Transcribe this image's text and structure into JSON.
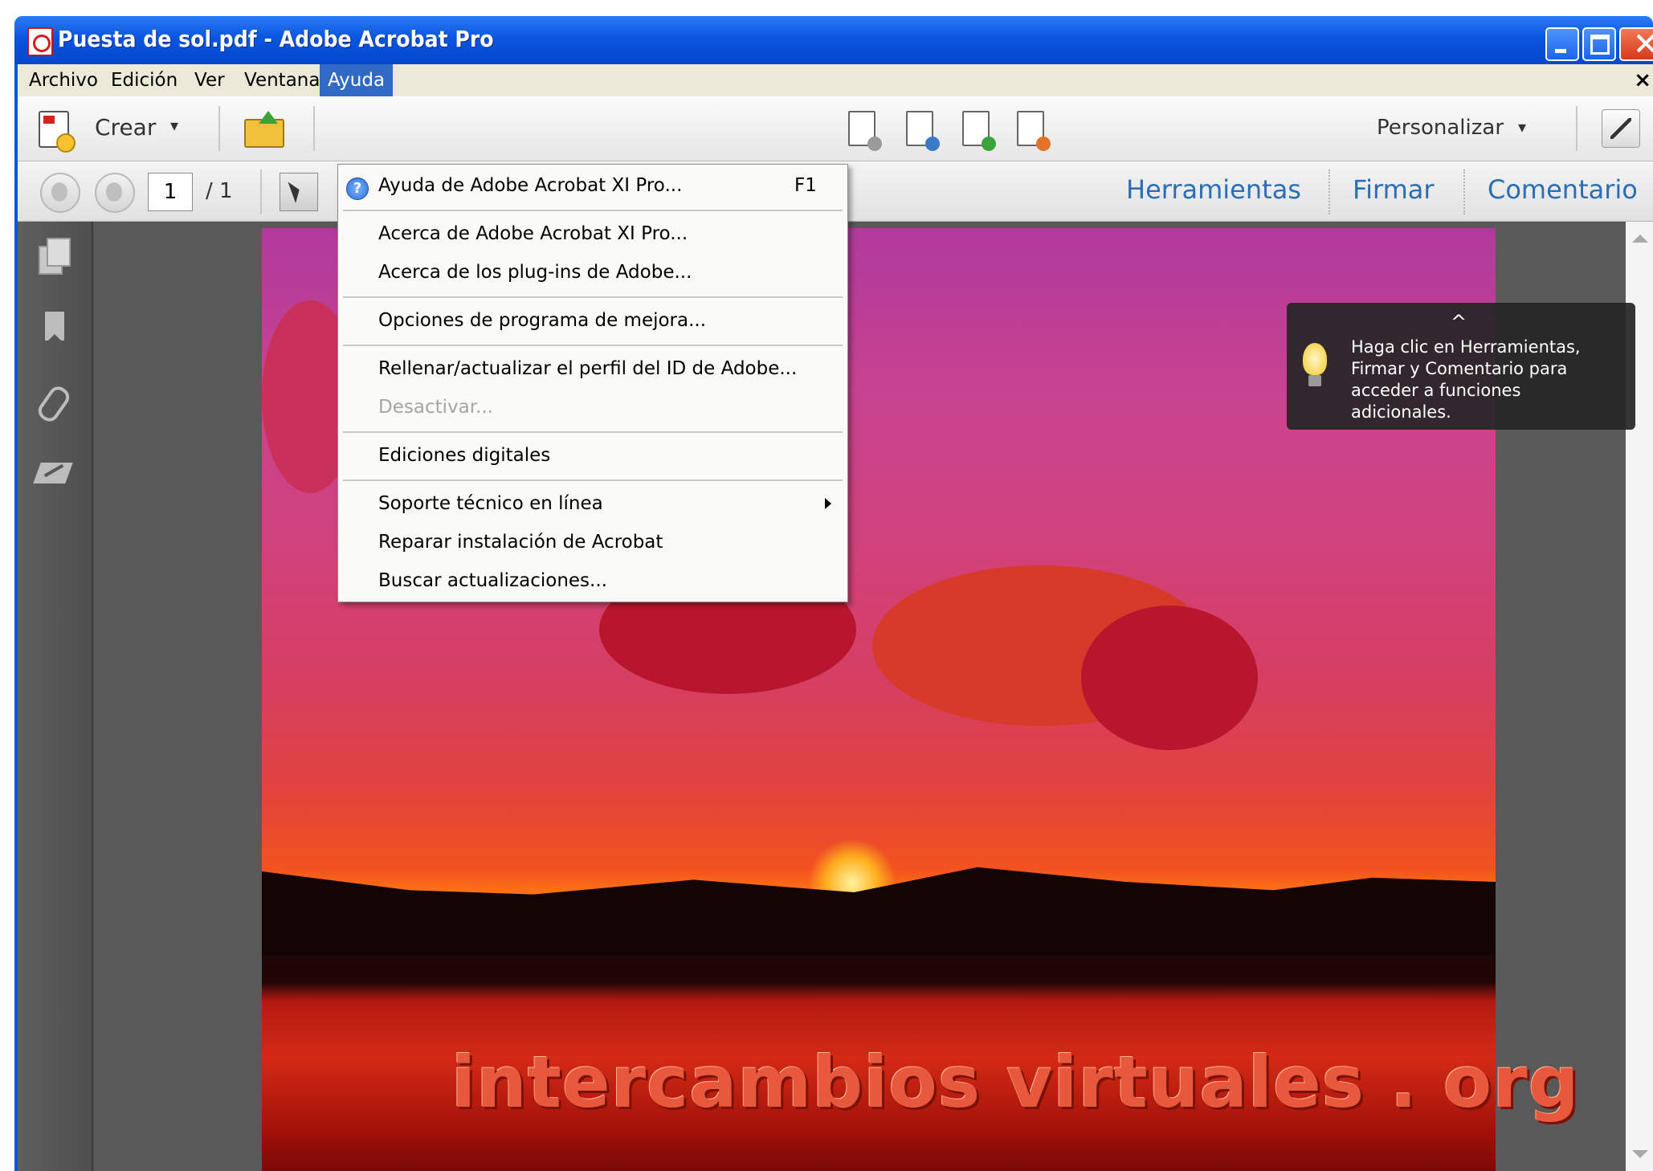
{
  "window": {
    "title": "Puesta de sol.pdf - Adobe Acrobat Pro"
  },
  "menubar": {
    "items": [
      {
        "label": "Archivo"
      },
      {
        "label": "Edición"
      },
      {
        "label": "Ver"
      },
      {
        "label": "Ventana"
      },
      {
        "label": "Ayuda",
        "active": true
      }
    ],
    "close_glyph": "×"
  },
  "toolbar": {
    "create_label": "Crear",
    "create_arrow": "▾",
    "customize_label": "Personalizar",
    "customize_arrow": "▾"
  },
  "navbar": {
    "page_current": "1",
    "page_total": "/ 1",
    "panes": [
      "Herramientas",
      "Firmar",
      "Comentario"
    ]
  },
  "help_menu": {
    "items": [
      {
        "label": "Ayuda de Adobe Acrobat XI Pro...",
        "shortcut": "F1",
        "icon": "help-circle-icon",
        "enabled": true
      },
      {
        "label": "Acerca de Adobe Acrobat XI Pro...",
        "enabled": true
      },
      {
        "label": "Acerca de los plug-ins de Adobe...",
        "enabled": true
      },
      {
        "label": "Opciones de programa de mejora...",
        "enabled": true
      },
      {
        "label": "Rellenar/actualizar el perfil del ID de Adobe...",
        "enabled": true
      },
      {
        "label": "Desactivar...",
        "enabled": false
      },
      {
        "label": "Ediciones digitales",
        "enabled": true
      },
      {
        "label": "Soporte técnico en línea",
        "submenu": true,
        "enabled": true
      },
      {
        "label": "Reparar instalación de Acrobat",
        "enabled": true
      },
      {
        "label": "Buscar actualizaciones...",
        "enabled": true
      }
    ]
  },
  "tooltip": {
    "caret": "^",
    "text": "Haga clic en Herramientas, Firmar y Comentario para acceder a funciones adicionales."
  },
  "document": {
    "watermark": "intercambios virtuales . org"
  },
  "colors": {
    "titlebar": "#0a55e0",
    "menu_active": "#316ac5",
    "pane_link": "#2a6fb5",
    "tooltip_bg": "#262626"
  }
}
